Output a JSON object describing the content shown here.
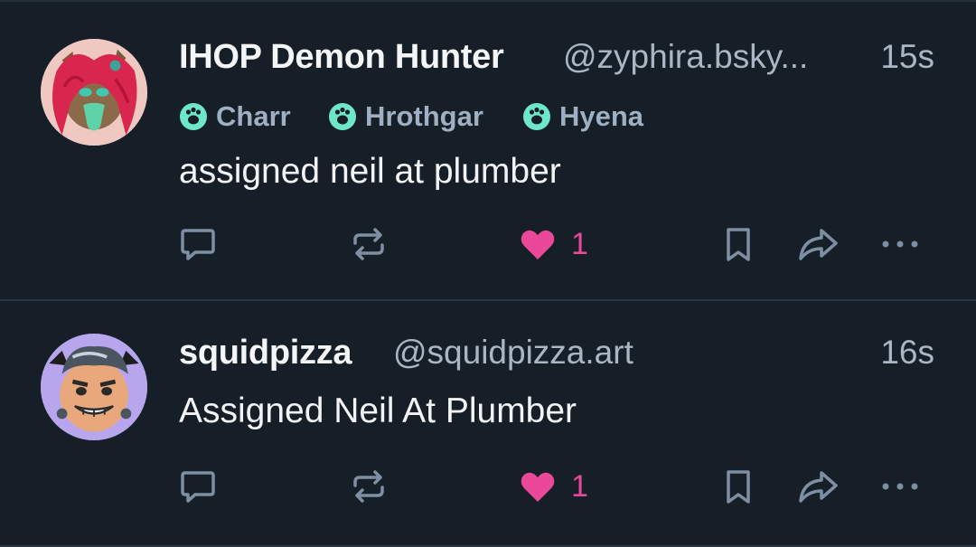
{
  "posts": [
    {
      "display_name": "IHOP Demon Hunter",
      "handle": "@zyphira.bsky...",
      "time": "15s",
      "tags": [
        {
          "label": "Charr",
          "icon": "paw-icon"
        },
        {
          "label": "Hrothgar",
          "icon": "paw-icon"
        },
        {
          "label": "Hyena",
          "icon": "paw-icon"
        }
      ],
      "text": "assigned neil at plumber",
      "likes": "1"
    },
    {
      "display_name": "squidpizza",
      "handle": "@squidpizza.art",
      "time": "16s",
      "text": "Assigned Neil At Plumber",
      "likes": "1"
    }
  ],
  "colors": {
    "background": "#161e27",
    "muted": "#aab6c4",
    "tag_icon": "#6ee7c8",
    "like": "#ec4899",
    "action_icon": "#7f8fa3"
  }
}
